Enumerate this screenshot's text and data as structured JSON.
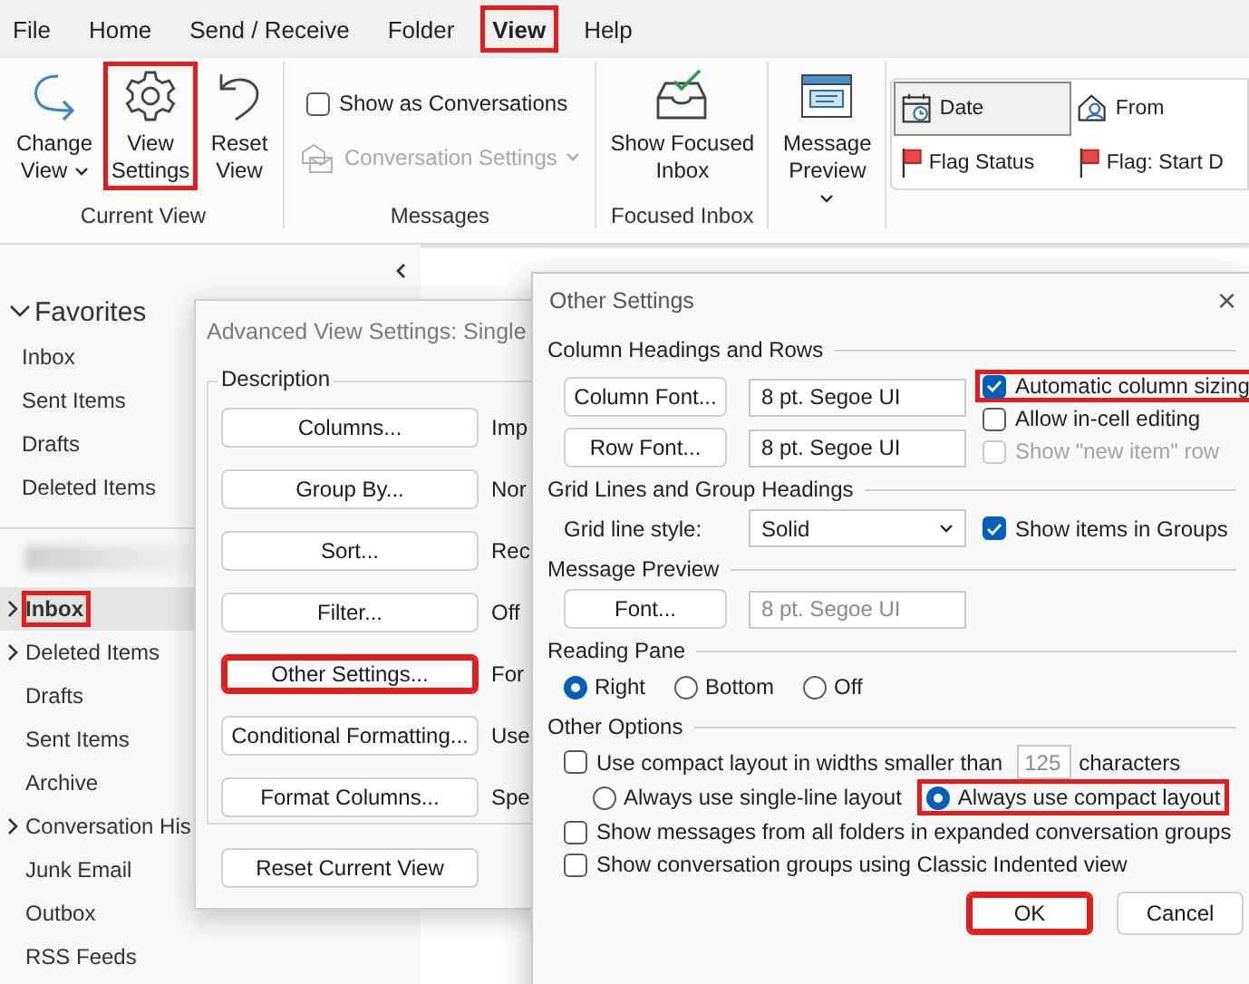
{
  "menu_bar": {
    "tabs": [
      {
        "label": "File",
        "selected": false,
        "highlighted": false
      },
      {
        "label": "Home",
        "selected": false,
        "highlighted": false
      },
      {
        "label": "Send / Receive",
        "selected": false,
        "highlighted": false
      },
      {
        "label": "Folder",
        "selected": false,
        "highlighted": false
      },
      {
        "label": "View",
        "selected": true,
        "highlighted": true
      },
      {
        "label": "Help",
        "selected": false,
        "highlighted": false
      }
    ]
  },
  "ribbon": {
    "groups": [
      {
        "label": "Current View",
        "items": [
          {
            "kind": "large-button",
            "label": "Change View",
            "dropdown": true,
            "highlighted": false
          },
          {
            "kind": "large-button",
            "label": "View Settings",
            "dropdown": false,
            "highlighted": true
          },
          {
            "kind": "large-button",
            "label": "Reset View",
            "dropdown": false,
            "highlighted": false
          }
        ]
      },
      {
        "label": "Messages",
        "items": [
          {
            "kind": "checkbox",
            "label": "Show as Conversations",
            "checked": false
          },
          {
            "kind": "menu-button",
            "label": "Conversation Settings",
            "dropdown": true,
            "disabled": true
          }
        ]
      },
      {
        "label": "Focused Inbox",
        "items": [
          {
            "kind": "large-button",
            "label": "Show Focused Inbox",
            "dropdown": false,
            "highlighted": false
          }
        ]
      },
      {
        "items": [
          {
            "kind": "large-button",
            "label": "Message Preview",
            "dropdown": true,
            "highlighted": false
          }
        ]
      }
    ],
    "arrangements": [
      {
        "label": "Date",
        "selected": true
      },
      {
        "label": "From",
        "selected": false
      },
      {
        "label": "Flag Status",
        "selected": false
      },
      {
        "label": "Flag: Start D",
        "selected": false
      }
    ]
  },
  "sidebar": {
    "favorites": {
      "label": "Favorites",
      "expanded": true,
      "items": [
        {
          "label": "Inbox",
          "selected": false
        },
        {
          "label": "Sent Items",
          "selected": false
        },
        {
          "label": "Drafts",
          "selected": false
        },
        {
          "label": "Deleted Items",
          "selected": false
        }
      ]
    },
    "account": {
      "folders": [
        {
          "label": "Inbox",
          "selected": true,
          "expandable": true,
          "highlighted": true
        },
        {
          "label": "Deleted Items",
          "selected": false,
          "expandable": true,
          "highlighted": false
        },
        {
          "label": "Drafts",
          "selected": false,
          "expandable": false,
          "highlighted": false
        },
        {
          "label": "Sent Items",
          "selected": false,
          "expandable": false,
          "highlighted": false
        },
        {
          "label": "Archive",
          "selected": false,
          "expandable": false,
          "highlighted": false
        },
        {
          "label": "Conversation His",
          "selected": false,
          "expandable": true,
          "highlighted": false
        },
        {
          "label": "Junk Email",
          "selected": false,
          "expandable": false,
          "highlighted": false
        },
        {
          "label": "Outbox",
          "selected": false,
          "expandable": false,
          "highlighted": false
        },
        {
          "label": "RSS Feeds",
          "selected": false,
          "expandable": false,
          "highlighted": false
        }
      ]
    }
  },
  "advanced_view_settings": {
    "title": "Advanced View Settings: Single",
    "group_label": "Description",
    "rows": [
      {
        "button": "Columns...",
        "description": "Imp",
        "highlighted": false
      },
      {
        "button": "Group By...",
        "description": "Nor",
        "highlighted": false
      },
      {
        "button": "Sort...",
        "description": "Rec",
        "highlighted": false
      },
      {
        "button": "Filter...",
        "description": "Off",
        "highlighted": false
      },
      {
        "button": "Other Settings...",
        "description": "For",
        "highlighted": true
      },
      {
        "button": "Conditional Formatting...",
        "description": "Use",
        "highlighted": false
      },
      {
        "button": "Format Columns...",
        "description": "Spe",
        "highlighted": false
      }
    ],
    "reset_button": "Reset Current View"
  },
  "other_settings": {
    "title": "Other Settings",
    "close": "×",
    "column_headings": {
      "title": "Column Headings and Rows",
      "fonts": [
        {
          "button": "Column Font...",
          "value": "8 pt. Segoe UI"
        },
        {
          "button": "Row Font...",
          "value": "8 pt. Segoe UI"
        }
      ],
      "options": [
        {
          "label": "Automatic column sizing",
          "checked": true,
          "disabled": false,
          "highlighted": true
        },
        {
          "label": "Allow in-cell editing",
          "checked": false,
          "disabled": false,
          "highlighted": false
        },
        {
          "label": "Show \"new item\" row",
          "checked": false,
          "disabled": true,
          "highlighted": false
        }
      ]
    },
    "grid_lines": {
      "title": "Grid Lines and Group Headings",
      "style_label": "Grid line style:",
      "style_value": "Solid",
      "show_in_groups": {
        "label": "Show items in Groups",
        "checked": true
      }
    },
    "message_preview": {
      "title": "Message Preview",
      "button": "Font...",
      "value": "8 pt. Segoe UI",
      "disabled": true
    },
    "reading_pane": {
      "title": "Reading Pane",
      "options": [
        {
          "label": "Right",
          "selected": true
        },
        {
          "label": "Bottom",
          "selected": false
        },
        {
          "label": "Off",
          "selected": false
        }
      ]
    },
    "other_options": {
      "title": "Other Options",
      "compact_width": {
        "label": "Use compact layout in widths smaller than",
        "value": "125",
        "suffix": "characters",
        "checked": false,
        "value_disabled": true
      },
      "layout_choices": [
        {
          "label": "Always use single-line layout",
          "selected": false,
          "highlighted": false
        },
        {
          "label": "Always use compact layout",
          "selected": true,
          "highlighted": true
        }
      ],
      "options": [
        {
          "label": "Show messages from all folders in expanded conversation groups",
          "checked": false
        },
        {
          "label": "Show conversation groups using Classic Indented view",
          "checked": false
        }
      ]
    },
    "buttons": [
      {
        "label": "OK",
        "highlighted": true
      },
      {
        "label": "Cancel",
        "highlighted": false
      }
    ]
  }
}
